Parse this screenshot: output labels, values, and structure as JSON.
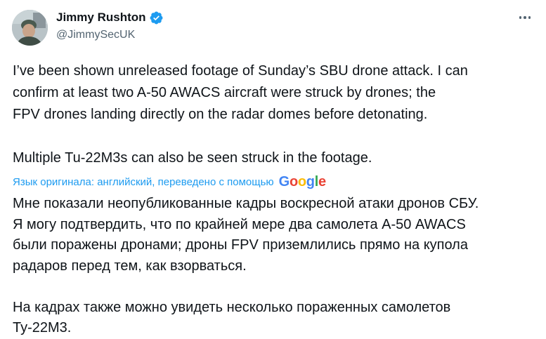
{
  "author": {
    "name": "Jimmy Rushton",
    "handle": "@JimmySecUK"
  },
  "tweet": {
    "paragraph1_line1": "I’ve been shown unreleased footage of Sunday’s SBU drone attack. I can",
    "paragraph1_line2": "confirm at least two A-50 AWACS aircraft were struck by drones; the",
    "paragraph1_line3": "FPV drones landing directly on the radar domes before detonating.",
    "paragraph2": "Multiple Tu-22M3s can also be seen struck in the footage."
  },
  "translation_notice": {
    "text": "Язык оригинала: английский, переведено с помощью",
    "provider_letters": [
      "G",
      "o",
      "o",
      "g",
      "l",
      "e"
    ],
    "provider_colors": [
      "#4285F4",
      "#EA4335",
      "#FBBC05",
      "#4285F4",
      "#34A853",
      "#EA4335"
    ]
  },
  "translation": {
    "line1": "Мне показали неопубликованные кадры воскресной атаки дронов СБУ.",
    "line2": "Я могу подтвердить, что по крайней мере два самолета А-50 AWACS",
    "line3": "были поражены дронами; дроны FPV приземлились прямо на купола",
    "line4": "радаров перед тем, как взорваться.",
    "line5": "На кадрах также можно увидеть несколько пораженных самолетов",
    "line6": "Ту-22М3."
  },
  "colors": {
    "verified_badge": "#1d9bf0",
    "link_blue": "#1d9bf0",
    "secondary_text": "#536471"
  },
  "icons": {
    "verified": "verified-badge-icon",
    "more": "more-options-icon"
  }
}
